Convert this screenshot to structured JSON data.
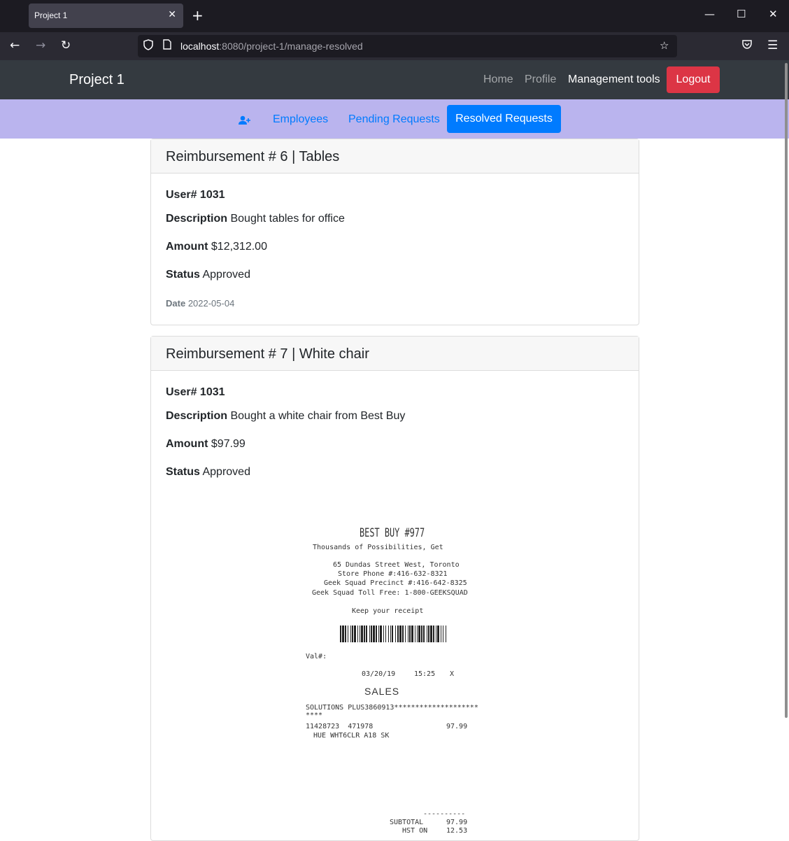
{
  "browser": {
    "tab_title": "Project 1",
    "url_host": "localhost",
    "url_rest": ":8080/project-1/manage-resolved"
  },
  "app": {
    "brand": "Project 1",
    "nav": [
      "Home",
      "Profile",
      "Management tools"
    ],
    "logout": "Logout"
  },
  "subnav": {
    "add_user_icon": "user-plus-icon",
    "items": [
      "Employees",
      "Pending Requests",
      "Resolved Requests"
    ]
  },
  "reimbursements": [
    {
      "title": "Reimbursement # 6 | Tables",
      "user_label": "User# 1031",
      "description_label": "Description",
      "description": "Bought tables for office",
      "amount_label": "Amount",
      "amount": "$12,312.00",
      "status_label": "Status",
      "status": "Approved",
      "date_label": "Date",
      "date": "2022-05-04"
    },
    {
      "title": "Reimbursement # 7 | White chair",
      "user_label": "User# 1031",
      "description_label": "Description",
      "description": "Bought a white chair from Best Buy",
      "amount_label": "Amount",
      "amount": "$97.99",
      "status_label": "Status",
      "status": "Approved"
    }
  ],
  "receipt": {
    "store": "BEST BUY #977",
    "tagline": "Thousands of Possibilities, Get",
    "address": "65 Dundas Street West, Toronto",
    "phone": "Store Phone #:416-632-8321",
    "precinct": "Geek Squad Precinct #:416-642-8325",
    "tollfree": "Geek Squad Toll Free: 1-800-GEEKSQUAD",
    "keep": "Keep your receipt",
    "val": "Val#:",
    "date": "03/20/19",
    "time": "15:25",
    "mark": "X",
    "sales": "SALES",
    "solutions": "SOLUTIONS PLUS3860913********************",
    "stars": "****",
    "sku": "11428723  471978",
    "price": "97.99",
    "item": "HUE WHT6CLR A18 SK",
    "dashes": "----------",
    "subtotal_label": "SUBTOTAL",
    "subtotal": "97.99",
    "hst_label": "HST ON",
    "hst": "12.53"
  }
}
